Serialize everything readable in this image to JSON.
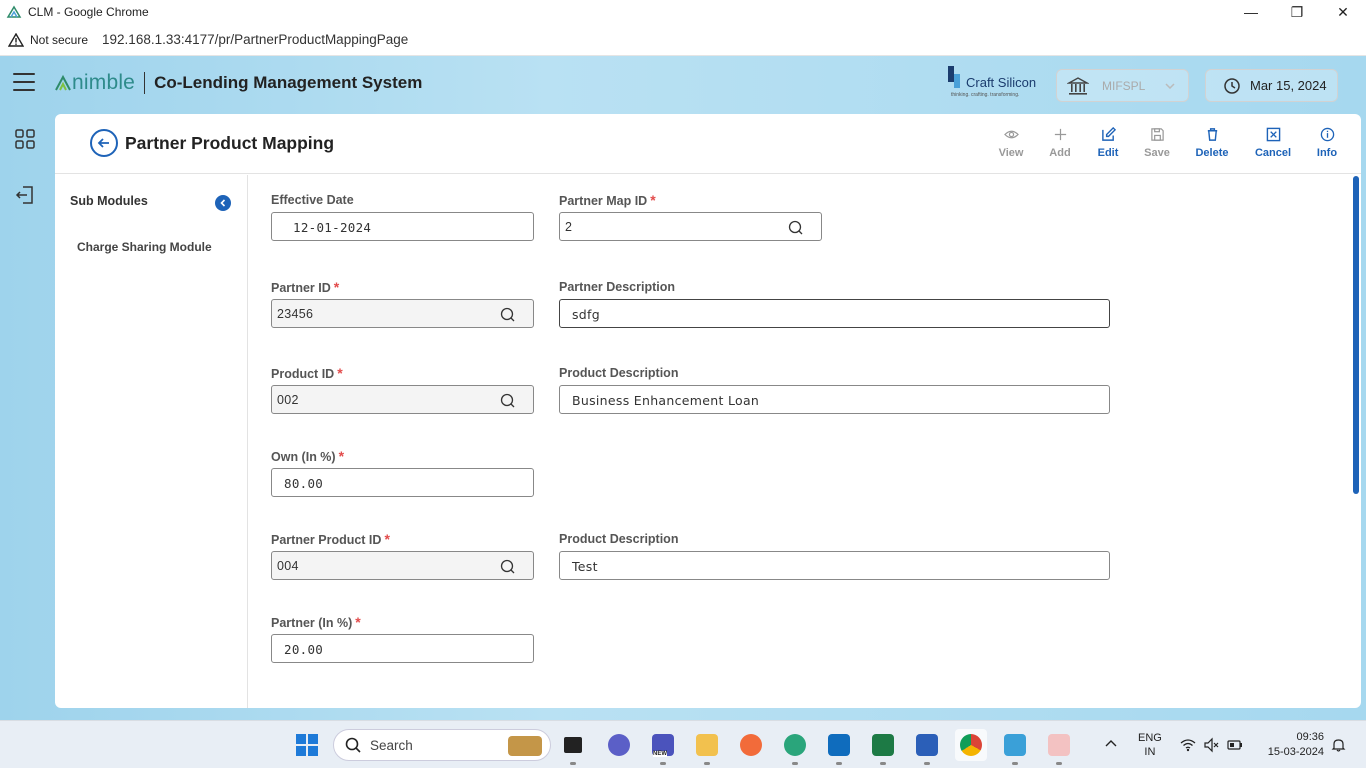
{
  "browser": {
    "window_title": "CLM - Google Chrome",
    "security_label": "Not secure",
    "url": "192.168.1.33:4177/pr/PartnerProductMappingPage"
  },
  "header": {
    "brand": "nimble",
    "system_name": "Co-Lending Management System",
    "partner_logo_name": "Craft Silicon",
    "partner_logo_tagline": "thinking. crafting. transforming.",
    "branch_value": "MIFSPL",
    "date": "Mar 15, 2024"
  },
  "page": {
    "title": "Partner Product Mapping"
  },
  "toolbar": {
    "view": "View",
    "add": "Add",
    "edit": "Edit",
    "save": "Save",
    "delete": "Delete",
    "cancel": "Cancel",
    "info": "Info"
  },
  "sub_modules": {
    "title": "Sub Modules",
    "items": [
      "Charge Sharing Module"
    ]
  },
  "form": {
    "effective_date": {
      "label": "Effective Date",
      "value": "12-01-2024"
    },
    "partner_map_id": {
      "label": "Partner Map ID",
      "value": "2"
    },
    "partner_id": {
      "label": "Partner ID",
      "value": "23456"
    },
    "partner_description": {
      "label": "Partner Description",
      "value": "sdfg"
    },
    "product_id": {
      "label": "Product ID",
      "value": "002"
    },
    "product_description": {
      "label": "Product Description",
      "value": "Business Enhancement Loan"
    },
    "own_pct": {
      "label": "Own (In %)",
      "value": "80.00"
    },
    "partner_product_id": {
      "label": "Partner Product ID",
      "value": "004"
    },
    "partner_product_description": {
      "label": "Product Description",
      "value": "Test"
    },
    "partner_pct": {
      "label": "Partner (In %)",
      "value": "20.00"
    },
    "required_mark": "*"
  },
  "taskbar": {
    "search_label": "Search",
    "language_line1": "ENG",
    "language_line2": "IN",
    "time": "09:36",
    "date": "15-03-2024",
    "teams_badge": "NEW"
  },
  "colors": {
    "accent": "#1e63b8",
    "required": "#e24b4b",
    "header_bg": "#a6d8ef"
  }
}
